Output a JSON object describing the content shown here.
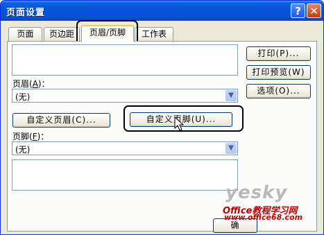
{
  "window": {
    "title": "页面设置"
  },
  "titlebar_buttons": {
    "help": "?",
    "close": "✕"
  },
  "tabs": [
    {
      "label": "页面"
    },
    {
      "label": "页边距"
    },
    {
      "label": "页眉/页脚"
    },
    {
      "label": "工作表"
    }
  ],
  "header": {
    "label": "页眉",
    "hotkey": "A",
    "label_suffix": "：",
    "value": "(无)"
  },
  "footer": {
    "label": "页脚",
    "hotkey": "F",
    "label_suffix": "：",
    "value": "(无)"
  },
  "buttons": {
    "print": "打印(P)...",
    "print_preview": "打印预览(W)",
    "options": "选项(O)...",
    "custom_header": "自定义页眉(C)...",
    "custom_footer": "自定义页脚(U)...",
    "ok_partial": "确"
  },
  "watermark": {
    "logo": "yesky",
    "text": "Office教程学习网",
    "url": "www.office68.com"
  },
  "colors": {
    "titlebar": "#0453d8",
    "dialog_bg": "#ece9d8",
    "watermark_red": "#c00000"
  }
}
